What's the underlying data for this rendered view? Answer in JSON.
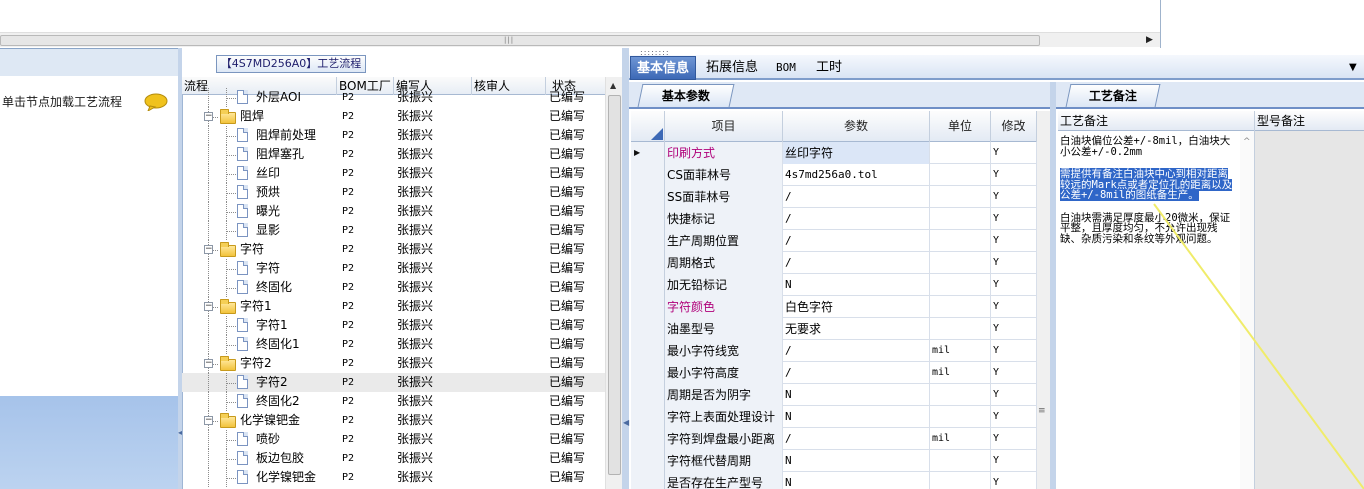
{
  "left_panel": {
    "message": "单击节点加载工艺流程"
  },
  "process": {
    "title": "【4S7MD256A0】工艺流程",
    "columns": [
      "流程",
      "BOM工厂",
      "编写人",
      "核审人",
      "状态"
    ],
    "rows": [
      {
        "level": 2,
        "type": "doc",
        "name": "外层AOI",
        "factory": "P2",
        "writer": "张振兴",
        "checker": "",
        "status": "已编写"
      },
      {
        "level": 1,
        "type": "folder",
        "name": "阻焊",
        "factory": "P2",
        "writer": "张振兴",
        "checker": "",
        "status": "已编写"
      },
      {
        "level": 2,
        "type": "doc",
        "name": "阻焊前处理",
        "factory": "P2",
        "writer": "张振兴",
        "checker": "",
        "status": "已编写"
      },
      {
        "level": 2,
        "type": "doc",
        "name": "阻焊塞孔",
        "factory": "P2",
        "writer": "张振兴",
        "checker": "",
        "status": "已编写"
      },
      {
        "level": 2,
        "type": "doc",
        "name": "丝印",
        "factory": "P2",
        "writer": "张振兴",
        "checker": "",
        "status": "已编写"
      },
      {
        "level": 2,
        "type": "doc",
        "name": "预烘",
        "factory": "P2",
        "writer": "张振兴",
        "checker": "",
        "status": "已编写"
      },
      {
        "level": 2,
        "type": "doc",
        "name": "曝光",
        "factory": "P2",
        "writer": "张振兴",
        "checker": "",
        "status": "已编写"
      },
      {
        "level": 2,
        "type": "doc",
        "name": "显影",
        "factory": "P2",
        "writer": "张振兴",
        "checker": "",
        "status": "已编写"
      },
      {
        "level": 1,
        "type": "folder",
        "name": "字符",
        "factory": "P2",
        "writer": "张振兴",
        "checker": "",
        "status": "已编写"
      },
      {
        "level": 2,
        "type": "doc",
        "name": "字符",
        "factory": "P2",
        "writer": "张振兴",
        "checker": "",
        "status": "已编写"
      },
      {
        "level": 2,
        "type": "doc",
        "name": "终固化",
        "factory": "P2",
        "writer": "张振兴",
        "checker": "",
        "status": "已编写"
      },
      {
        "level": 1,
        "type": "folder",
        "name": "字符1",
        "factory": "P2",
        "writer": "张振兴",
        "checker": "",
        "status": "已编写"
      },
      {
        "level": 2,
        "type": "doc",
        "name": "字符1",
        "factory": "P2",
        "writer": "张振兴",
        "checker": "",
        "status": "已编写"
      },
      {
        "level": 2,
        "type": "doc",
        "name": "终固化1",
        "factory": "P2",
        "writer": "张振兴",
        "checker": "",
        "status": "已编写"
      },
      {
        "level": 1,
        "type": "folder",
        "name": "字符2",
        "factory": "P2",
        "writer": "张振兴",
        "checker": "",
        "status": "已编写"
      },
      {
        "level": 2,
        "type": "doc",
        "name": "字符2",
        "factory": "P2",
        "writer": "张振兴",
        "checker": "",
        "status": "已编写",
        "selected": true
      },
      {
        "level": 2,
        "type": "doc",
        "name": "终固化2",
        "factory": "P2",
        "writer": "张振兴",
        "checker": "",
        "status": "已编写"
      },
      {
        "level": 1,
        "type": "folder",
        "name": "化学镍钯金",
        "factory": "P2",
        "writer": "张振兴",
        "checker": "",
        "status": "已编写"
      },
      {
        "level": 2,
        "type": "doc",
        "name": "喷砂",
        "factory": "P2",
        "writer": "张振兴",
        "checker": "",
        "status": "已编写"
      },
      {
        "level": 2,
        "type": "doc",
        "name": "板边包胶",
        "factory": "P2",
        "writer": "张振兴",
        "checker": "",
        "status": "已编写"
      },
      {
        "level": 2,
        "type": "doc",
        "name": "化学镍钯金",
        "factory": "P2",
        "writer": "张振兴",
        "checker": "",
        "status": "已编写"
      }
    ]
  },
  "main_tabs": [
    {
      "label": "基本信息",
      "active": true
    },
    {
      "label": "拓展信息",
      "active": false
    },
    {
      "label": "BOM",
      "active": false
    },
    {
      "label": "工时",
      "active": false
    }
  ],
  "params": {
    "tab": "基本参数",
    "columns": [
      "项目",
      "参数",
      "单位",
      "修改"
    ],
    "rows": [
      {
        "item": "印刷方式",
        "param": "丝印字符",
        "unit": "",
        "mod": "Y",
        "current": true,
        "highlight_item": true,
        "highlight_param": true
      },
      {
        "item": "CS面菲林号",
        "param": "4s7md256a0.tol",
        "unit": "",
        "mod": "Y"
      },
      {
        "item": "SS面菲林号",
        "param": "/",
        "unit": "",
        "mod": "Y"
      },
      {
        "item": "快捷标记",
        "param": "/",
        "unit": "",
        "mod": "Y"
      },
      {
        "item": "生产周期位置",
        "param": "/",
        "unit": "",
        "mod": "Y"
      },
      {
        "item": "周期格式",
        "param": "/",
        "unit": "",
        "mod": "Y"
      },
      {
        "item": "加无铅标记",
        "param": "N",
        "unit": "",
        "mod": "Y"
      },
      {
        "item": "字符颜色",
        "param": "白色字符",
        "unit": "",
        "mod": "Y",
        "highlight_item": true
      },
      {
        "item": "油墨型号",
        "param": "无要求",
        "unit": "",
        "mod": "Y"
      },
      {
        "item": "最小字符线宽",
        "param": "/",
        "unit": "mil",
        "mod": "Y"
      },
      {
        "item": "最小字符高度",
        "param": "/",
        "unit": "mil",
        "mod": "Y"
      },
      {
        "item": "周期是否为阴字",
        "param": "N",
        "unit": "",
        "mod": "Y"
      },
      {
        "item": "字符上表面处理设计",
        "param": "N",
        "unit": "",
        "mod": "Y"
      },
      {
        "item": "字符到焊盘最小距离",
        "param": "/",
        "unit": "mil",
        "mod": "Y"
      },
      {
        "item": "字符框代替周期",
        "param": "N",
        "unit": "",
        "mod": "Y"
      },
      {
        "item": "是否存在生产型号",
        "param": "N",
        "unit": "",
        "mod": "Y"
      }
    ]
  },
  "notes": {
    "tab": "工艺备注",
    "col_notes": "工艺备注",
    "col_model": "型号备注",
    "paragraphs": [
      {
        "text": "白油块偏位公差+/-8mil，白油块大小公差+/-0.2mm",
        "highlight": false
      },
      {
        "text": "需提供有备注白油块中心到相对距离较远的Mark点或者定位孔的距离以及公差+/-8mil的图纸备生产。",
        "highlight": true
      },
      {
        "text": "白油块需满足厚度最小20微米，保证平整，且厚度均匀，不允许出现残缺、杂质污染和条纹等外观问题。",
        "highlight": false
      }
    ]
  },
  "colors": {
    "accent": "#3d69b6",
    "highlight_item_text": "#b0007a",
    "selection": "#2f66c8",
    "annotation_line": "#f0ec6a"
  }
}
